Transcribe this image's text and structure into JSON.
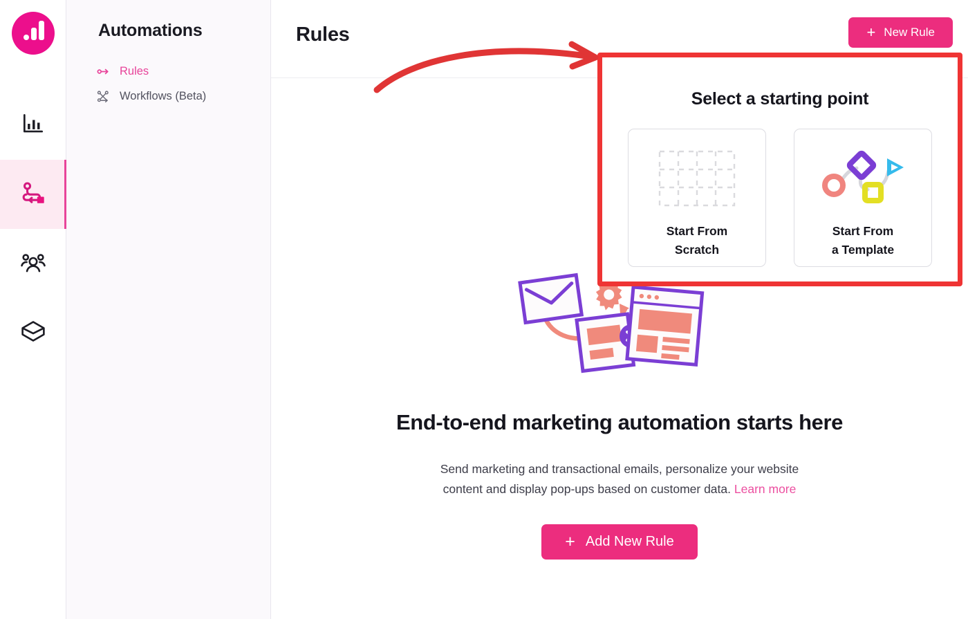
{
  "brand": {
    "logo_icon": "bar-chart-logo-icon",
    "accent_pink": "#ec0f8c",
    "button_pink": "#ec2d7e",
    "link_pink": "#ec4fa0",
    "highlight_red": "#ef3434"
  },
  "rail": {
    "items": [
      {
        "icon": "analytics-bar-chart-icon",
        "name": "analytics",
        "active": false
      },
      {
        "icon": "automations-flow-icon",
        "name": "automations",
        "active": true
      },
      {
        "icon": "audience-people-icon",
        "name": "audience",
        "active": false
      },
      {
        "icon": "products-box-icon",
        "name": "products",
        "active": false
      }
    ]
  },
  "sidebar": {
    "title": "Automations",
    "items": [
      {
        "label": "Rules",
        "icon": "rule-arrow-icon",
        "active": true
      },
      {
        "label": "Workflows (Beta)",
        "icon": "workflow-nodes-icon",
        "active": false
      }
    ]
  },
  "header": {
    "title": "Rules",
    "new_rule_button": "New Rule",
    "plus": "+"
  },
  "popup": {
    "heading": "Select a starting point",
    "cards": [
      {
        "label_line1": "Start From",
        "label_line2": "Scratch",
        "icon": "dashed-grid-icon"
      },
      {
        "label_line1": "Start From",
        "label_line2": "a Template",
        "icon": "template-shapes-flow-icon"
      }
    ]
  },
  "empty_state": {
    "illustration_icon": "marketing-automation-illustration",
    "title": "End-to-end marketing automation starts here",
    "description_line1": "Send marketing and transactional emails, personalize your website",
    "description_line2": "content and display pop-ups based on customer data.",
    "learn_more": "Learn more",
    "add_button": "Add New Rule",
    "plus": "+"
  },
  "annotation": {
    "arrow_icon": "red-curved-arrow-annotation"
  }
}
